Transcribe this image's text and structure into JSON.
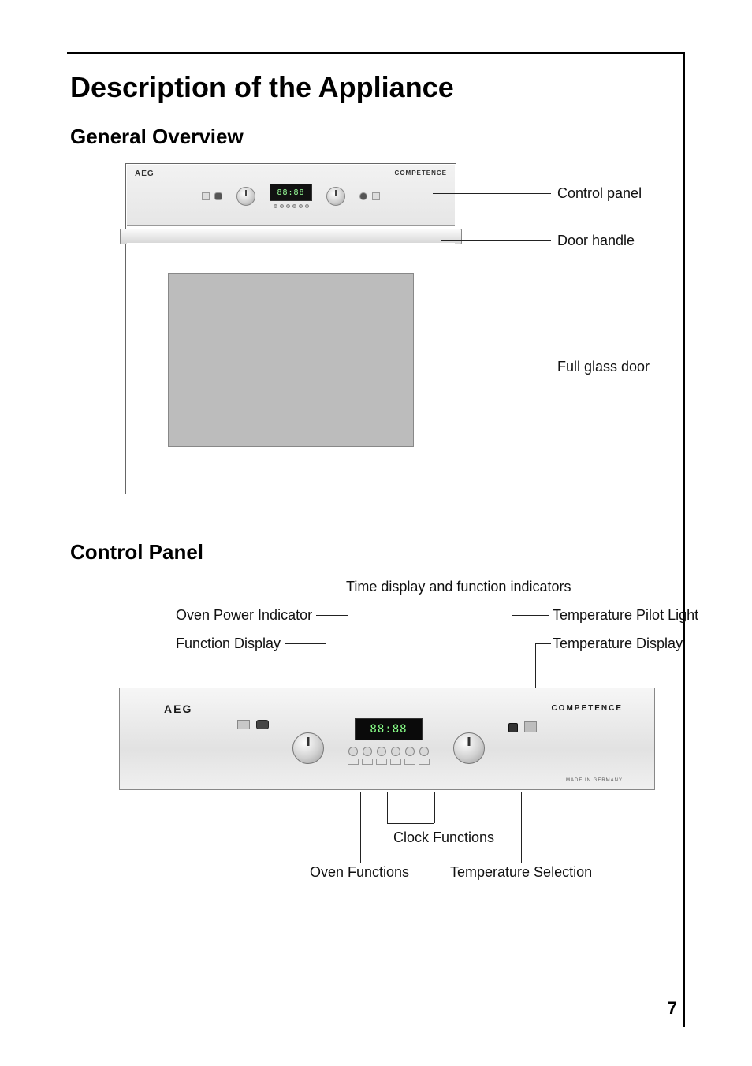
{
  "page_number": "7",
  "title": "Description of the Appliance",
  "section1": {
    "heading": "General Overview",
    "brand_left": "AEG",
    "brand_right": "COMPETENCE",
    "display_text": "88:88",
    "callouts": {
      "control_panel": "Control panel",
      "door_handle": "Door handle",
      "full_glass_door": "Full glass door"
    }
  },
  "section2": {
    "heading": "Control Panel",
    "brand_left": "AEG",
    "brand_right": "COMPETENCE",
    "made_in": "MADE IN GERMANY",
    "display_text": "88:88",
    "labels": {
      "time_display": "Time display and function indicators",
      "oven_power_indicator": "Oven Power Indicator",
      "function_display": "Function Display",
      "temperature_pilot_light": "Temperature Pilot Light",
      "temperature_display": "Temperature Display",
      "clock_functions": "Clock Functions",
      "oven_functions": "Oven Functions",
      "temperature_selection": "Temperature Selection"
    }
  }
}
